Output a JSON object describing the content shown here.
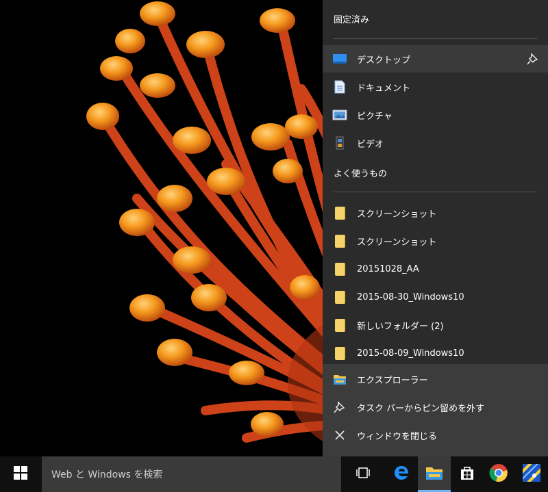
{
  "jumplist": {
    "pinned_header": "固定済み",
    "pinned": [
      {
        "label": "デスクトップ",
        "icon": "desktop-icon"
      },
      {
        "label": "ドキュメント",
        "icon": "documents-icon"
      },
      {
        "label": "ピクチャ",
        "icon": "pictures-icon"
      },
      {
        "label": "ビデオ",
        "icon": "videos-icon"
      }
    ],
    "frequent_header": "よく使うもの",
    "frequent": [
      {
        "label": "スクリーンショット",
        "icon": "folder-icon"
      },
      {
        "label": "スクリーンショット",
        "icon": "folder-icon"
      },
      {
        "label": "20151028_AA",
        "icon": "folder-icon"
      },
      {
        "label": "2015-08-30_Windows10",
        "icon": "folder-icon"
      },
      {
        "label": "新しいフォルダー (2)",
        "icon": "folder-icon"
      },
      {
        "label": "2015-08-09_Windows10",
        "icon": "folder-icon"
      }
    ],
    "actions": [
      {
        "label": "エクスプローラー",
        "icon": "file-explorer-icon"
      },
      {
        "label": "タスク バーからピン留めを外す",
        "icon": "unpin-icon"
      },
      {
        "label": "ウィンドウを閉じる",
        "icon": "close-icon"
      }
    ]
  },
  "taskbar": {
    "search_placeholder": "Web と Windows を検索",
    "icons": [
      "task-view-icon",
      "edge-icon",
      "file-explorer-icon",
      "store-icon",
      "chrome-icon",
      "app-icon"
    ]
  },
  "colors": {
    "accent": "#6fb3f2",
    "jumplist_bg": "#2b2b2b",
    "taskbar_bg": "#101010",
    "folder": "#f6d36a"
  }
}
